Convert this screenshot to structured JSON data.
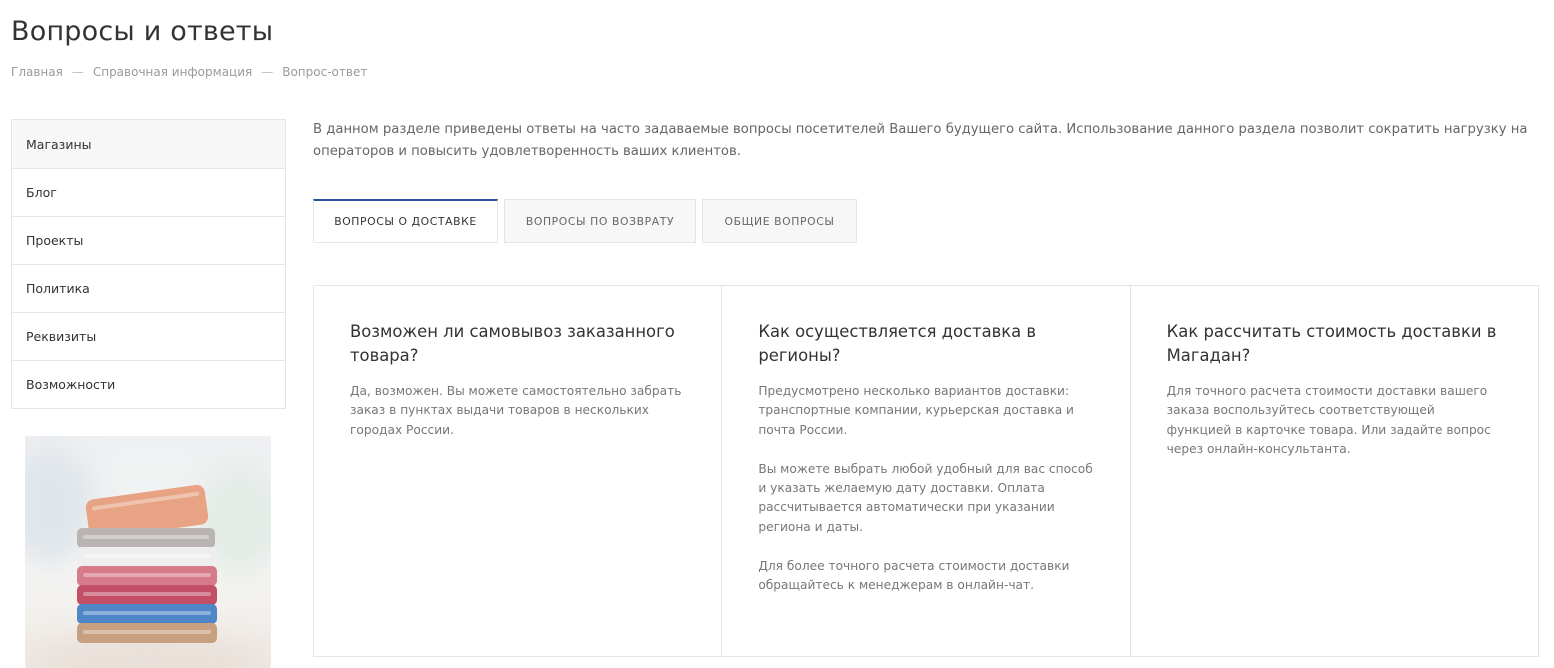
{
  "page": {
    "title": "Вопросы и ответы"
  },
  "breadcrumb": {
    "items": [
      "Главная",
      "Справочная информация",
      "Вопрос-ответ"
    ],
    "separator": "—"
  },
  "sidebar": {
    "items": [
      {
        "label": "Магазины"
      },
      {
        "label": "Блог"
      },
      {
        "label": "Проекты"
      },
      {
        "label": "Политика"
      },
      {
        "label": "Реквизиты"
      },
      {
        "label": "Возможности"
      }
    ]
  },
  "intro": {
    "text": "В данном разделе приведены ответы на часто задаваемые вопросы посетителей Вашего будущего сайта. Использование данного раздела позволит сократить нагрузку на операторов и повысить удовлетворенность ваших клиентов."
  },
  "tabs": [
    {
      "label": "Вопросы о доставке",
      "active": true
    },
    {
      "label": "Вопросы по возврату",
      "active": false
    },
    {
      "label": "Общие вопросы",
      "active": false
    }
  ],
  "faq": [
    {
      "question": "Возможен ли самовывоз заказанного товара?",
      "answers": [
        "Да, возможен. Вы можете самостоятельно забрать заказ в пунктах выдачи товаров в нескольких городах России."
      ]
    },
    {
      "question": "Как осуществляется доставка в регионы?",
      "answers": [
        "Предусмотрено несколько вариантов доставки: транспортные компании, курьерская доставка и почта России.",
        "Вы можете выбрать любой удобный для вас способ и указать желаемую дату доставки. Оплата рассчитывается автоматически при указании региона и даты.",
        "Для более точного расчета стоимости доставки обращайтесь к менеджерам в онлайн-чат."
      ]
    },
    {
      "question": "Как рассчитать стоимость доставки в Магадан?",
      "answers": [
        "Для точного расчета стоимости доставки вашего заказа воспользуйтесь соответствующей функцией в карточке товара. Или задайте вопрос через онлайн-консультанта."
      ]
    }
  ],
  "colors": {
    "accent": "#2f4f9e",
    "border": "#e5e5e5",
    "muted_text": "#777777"
  },
  "promo": {
    "icon": "towels-stack-image"
  }
}
